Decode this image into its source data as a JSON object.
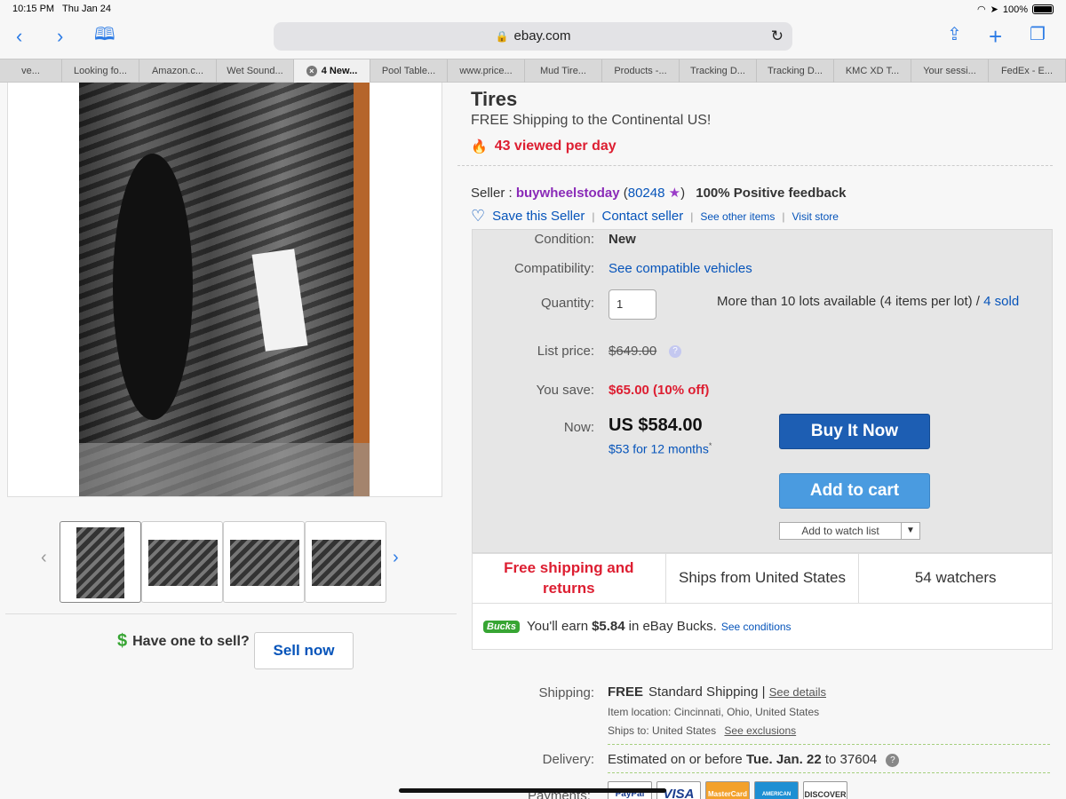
{
  "status_bar": {
    "time": "10:15 PM",
    "date": "Thu Jan 24",
    "battery": "100%"
  },
  "browser": {
    "url": "ebay.com",
    "tabs": [
      {
        "label": "ve..."
      },
      {
        "label": "Looking fo..."
      },
      {
        "label": "Amazon.c..."
      },
      {
        "label": "Wet Sound..."
      },
      {
        "label": "4 New...",
        "active": true
      },
      {
        "label": "Pool Table..."
      },
      {
        "label": "www.price..."
      },
      {
        "label": "Mud Tire..."
      },
      {
        "label": "Products -..."
      },
      {
        "label": "Tracking D..."
      },
      {
        "label": "Tracking D..."
      },
      {
        "label": "KMC XD T..."
      },
      {
        "label": "Your sessi..."
      },
      {
        "label": "FedEx - E..."
      }
    ]
  },
  "listing": {
    "title_tail": "Tires",
    "shipping_note": "FREE Shipping to the Continental US!",
    "viewed": "43 viewed per day"
  },
  "seller": {
    "prefix": "Seller :",
    "name": "buywheelstoday",
    "feedback_count": "80248",
    "positive": "100% Positive feedback",
    "save": "Save this Seller",
    "contact": "Contact seller",
    "other_items": "See other items",
    "visit_store": "Visit store"
  },
  "buybox": {
    "condition_label": "Condition:",
    "condition_value": "New",
    "compat_label": "Compatibility:",
    "compat_link": "See compatible vehicles",
    "quantity_label": "Quantity:",
    "quantity_value": "1",
    "availability": "More than 10 lots available (4 items per lot) /",
    "sold": "4 sold",
    "list_label": "List price:",
    "list_price": "$649.00",
    "save_label": "You save:",
    "save_value": "$65.00 (10% off)",
    "now_label": "Now:",
    "now_price": "US $584.00",
    "monthly": "$53 for 12 months",
    "buy_now": "Buy It Now",
    "add_cart": "Add to cart",
    "watch": "Add to watch list"
  },
  "info_strip": {
    "free_returns": "Free shipping and returns",
    "ships_from": "Ships from United States",
    "watchers": "54 watchers"
  },
  "bucks": {
    "logo": "Bucks",
    "pre": "You'll earn",
    "amount": "$5.84",
    "post": "in eBay Bucks.",
    "link": "See conditions"
  },
  "shipping": {
    "label": "Shipping:",
    "free": "FREE",
    "method": "Standard Shipping",
    "details": "See details",
    "location": "Item location: Cincinnati, Ohio, United States",
    "ships_to": "Ships to: United States",
    "exclusions": "See exclusions",
    "delivery_label": "Delivery:",
    "delivery_pre": "Estimated on or before",
    "delivery_date": "Tue. Jan. 22",
    "delivery_post": "to 37604",
    "payments_label": "Payments:"
  },
  "payment_logos": [
    "PayPal",
    "VISA",
    "MasterCard",
    "AMERICAN EXPRESS",
    "DISCOVER"
  ],
  "sell": {
    "question": "Have one to sell?",
    "button": "Sell now"
  },
  "colors": {
    "ebay_blue": "#0654ba",
    "buy_now": "#1d5eb3",
    "add_cart": "#4a9be0",
    "alert_red": "#dd1e31",
    "seller_purple": "#8a2bb8"
  }
}
